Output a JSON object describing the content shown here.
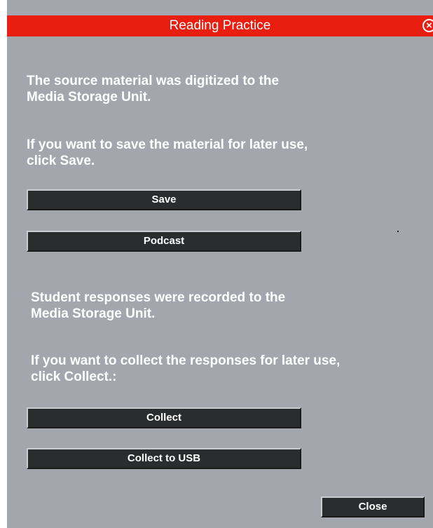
{
  "window": {
    "title": "Reading Practice",
    "close_icon": "close-circle-icon"
  },
  "content": {
    "paragraph1": "The source material was digitized to the\nMedia Storage Unit.",
    "paragraph2": "If you want to save the material for later use,\nclick Save.",
    "save_button": "Save",
    "podcast_button": "Podcast",
    "paragraph3": "Student responses were recorded to the\nMedia Storage Unit.",
    "paragraph4": "If you want to collect the responses for later use,\nclick Collect.:",
    "collect_button": "Collect",
    "collect_usb_button": "Collect to USB",
    "close_button": "Close"
  },
  "colors": {
    "titlebar": "#e81e10",
    "background": "#a3a7ad",
    "button": "#2b2c2d",
    "text": "#ffffff"
  }
}
